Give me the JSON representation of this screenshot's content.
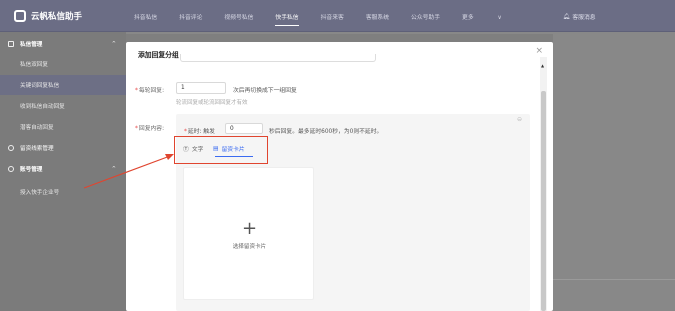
{
  "app": {
    "name": "云帆私信助手"
  },
  "nav": {
    "items": [
      "抖音私信",
      "抖音评论",
      "视频号私信",
      "快手私信",
      "抖音来客",
      "客服系统",
      "公众号助手",
      "更多"
    ],
    "active": "快手私信",
    "more_caret": "∨"
  },
  "header": {
    "notice": "客服消息"
  },
  "sidebar": {
    "group1": {
      "label": "私信管理",
      "caret": "^"
    },
    "items": [
      "私信双回复",
      "关键词回复私信",
      "收到私信自动回复",
      "潜客自动回复"
    ],
    "active_item": "关键词回复私信",
    "item_lead": "留资线索管理",
    "group2": {
      "label": "账号管理",
      "caret": "^"
    },
    "item_auth": "授入快手企业号"
  },
  "modal": {
    "title": "添加回复分组",
    "close": "×",
    "per_round": {
      "label": "每轮回复:",
      "value": "1",
      "suffix": "次后再切换成下一组回复",
      "hint": "轮流回复或轮流回回复才有效"
    },
    "content": {
      "label": "回复内容:",
      "delay_label": "延时: 触发",
      "delay_value": "0",
      "delay_suffix": "秒后回复。最多延时600秒，为0则不延时。",
      "tab_text": "文字",
      "tab_card": "留资卡片",
      "active_tab": "留资卡片",
      "card_plus": "+",
      "card_label": "选择留资卡片"
    }
  },
  "colors": {
    "accent": "#3b6bf1",
    "annotation_red": "#e0452f",
    "required": "#e84b4b"
  }
}
